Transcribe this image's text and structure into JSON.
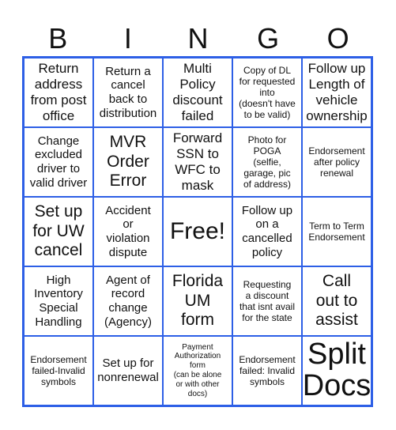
{
  "header": {
    "letters": [
      "B",
      "I",
      "N",
      "G",
      "O"
    ]
  },
  "theme": {
    "border_color": "#2d5fe6",
    "text_color": "#111111",
    "background": "#ffffff"
  },
  "cells": [
    [
      "Return\naddress\nfrom post\noffice",
      "Return a\ncancel\nback to\ndistribution",
      "Multi\nPolicy\ndiscount\nfailed",
      "Copy of DL\nfor requested\ninto\n(doesn't have\nto be valid)",
      "Follow up\nLength of\nvehicle\nownership"
    ],
    [
      "Change\nexcluded\ndriver to\nvalid driver",
      "MVR\nOrder\nError",
      "Forward\nSSN to\nWFC to\nmask",
      "Photo for\nPOGA\n(selfie,\ngarage, pic\nof address)",
      "Endorsement\nafter policy\nrenewal"
    ],
    [
      "Set up\nfor UW\ncancel",
      "Accident\nor\nviolation\ndispute",
      "Free!",
      "Follow up\non a\ncancelled\npolicy",
      "Term to Term\nEndorsement"
    ],
    [
      "High\nInventory\nSpecial\nHandling",
      "Agent of\nrecord\nchange\n(Agency)",
      "Florida\nUM\nform",
      "Requesting\na discount\nthat isnt avail\nfor the state",
      "Call\nout to\nassist"
    ],
    [
      "Endorsement\nfailed-Invalid\nsymbols",
      "Set up for\nnonrenewal",
      "Payment\nAuthorization\nform\n(can be alone\nor with other\ndocs)",
      "Endorsement\nfailed: Invalid\nsymbols",
      "Split\nDocs"
    ]
  ]
}
